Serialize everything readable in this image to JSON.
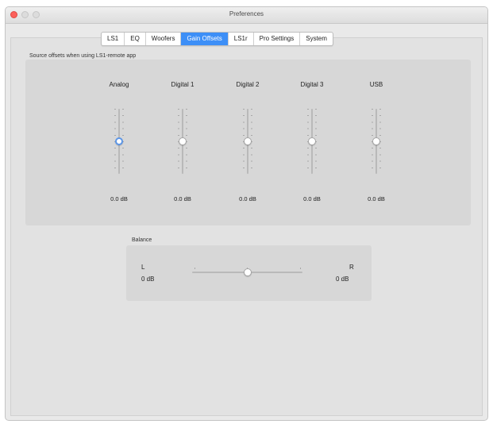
{
  "window": {
    "title": "Preferences",
    "controls": {
      "close": "close-icon",
      "minimize": "minimize-icon",
      "zoom": "zoom-icon"
    }
  },
  "tabs": [
    {
      "label": "LS1",
      "active": false
    },
    {
      "label": "EQ",
      "active": false
    },
    {
      "label": "Woofers",
      "active": false
    },
    {
      "label": "Gain Offsets",
      "active": true
    },
    {
      "label": "LS1r",
      "active": false
    },
    {
      "label": "Pro Settings",
      "active": false
    },
    {
      "label": "System",
      "active": false
    }
  ],
  "source_offsets": {
    "label": "Source offsets when using LS1-remote app",
    "channels": [
      {
        "name": "Analog",
        "value": "0.0 dB",
        "level": 0.5,
        "focused": true
      },
      {
        "name": "Digital 1",
        "value": "0.0 dB",
        "level": 0.5,
        "focused": false
      },
      {
        "name": "Digital 2",
        "value": "0.0 dB",
        "level": 0.5,
        "focused": false
      },
      {
        "name": "Digital 3",
        "value": "0.0 dB",
        "level": 0.5,
        "focused": false
      },
      {
        "name": "USB",
        "value": "0.0 dB",
        "level": 0.5,
        "focused": false
      }
    ]
  },
  "balance": {
    "label": "Balance",
    "left_label": "L",
    "right_label": "R",
    "left_value": "0 dB",
    "right_value": "0 dB",
    "level": 0.5
  },
  "colors": {
    "accent": "#3d8ff7",
    "close_button": "#fc605b",
    "panel": "#d7d7d7",
    "window_bg": "#e9e9e9"
  }
}
